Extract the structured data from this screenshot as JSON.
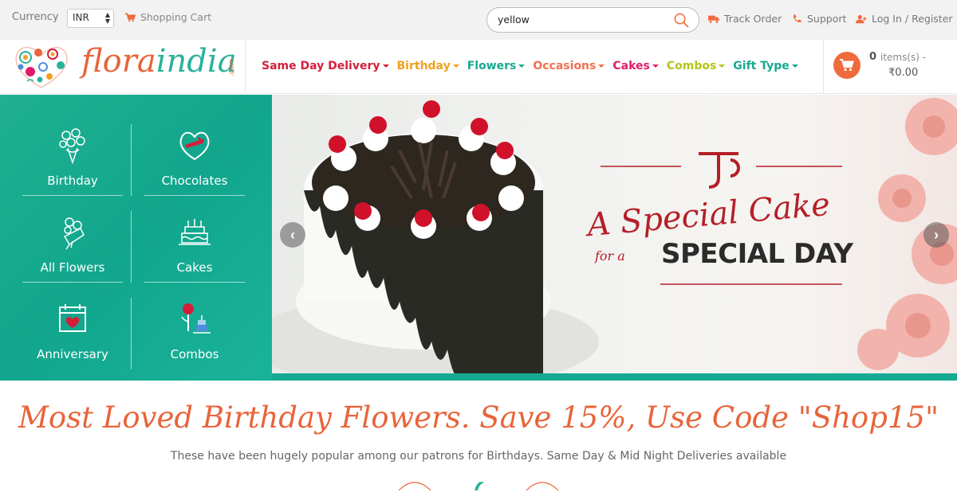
{
  "topbar": {
    "currency_label": "Currency",
    "currency_value": "INR",
    "shopping_cart": "Shopping Cart",
    "search_value": "yellow",
    "track_order": "Track Order",
    "support": "Support",
    "login": "Log In / Register"
  },
  "header": {
    "logo_text_a": "flora",
    "logo_text_b": "india",
    "logo_com": ".com",
    "nav": [
      {
        "label": "Same Day Delivery",
        "color": "#d41f3a"
      },
      {
        "label": "Birthday",
        "color": "#f0a020"
      },
      {
        "label": "Flowers",
        "color": "#1aa893"
      },
      {
        "label": "Occasions",
        "color": "#f07050"
      },
      {
        "label": "Cakes",
        "color": "#e01b6a"
      },
      {
        "label": "Combos",
        "color": "#b5c41a"
      },
      {
        "label": "Gift Type",
        "color": "#1aa893"
      }
    ],
    "cart_count": "0",
    "cart_items_label": "items(s) -",
    "cart_total": "₹0.00"
  },
  "categories": [
    {
      "label": "Birthday",
      "icon": "bouquet-icon"
    },
    {
      "label": "Chocolates",
      "icon": "chocolate-heart-icon"
    },
    {
      "label": "All Flowers",
      "icon": "flowers-icon"
    },
    {
      "label": "Cakes",
      "icon": "cake-icon"
    },
    {
      "label": "Anniversary",
      "icon": "calendar-heart-icon"
    },
    {
      "label": "Combos",
      "icon": "rose-cake-icon"
    }
  ],
  "banner": {
    "headline1": "A Special Cake",
    "for_text": "for a",
    "headline2": "SPECIAL DAY"
  },
  "promo": {
    "title": "Most Loved Birthday Flowers. Save 15%, Use Code \"Shop15\"",
    "subtitle": "These have been hugely popular among our patrons for Birthdays. Same Day & Mid Night Deliveries available"
  },
  "colors": {
    "brand_orange": "#e8643a",
    "brand_teal": "#1aa893",
    "cart_orange": "#ef6a3c"
  }
}
